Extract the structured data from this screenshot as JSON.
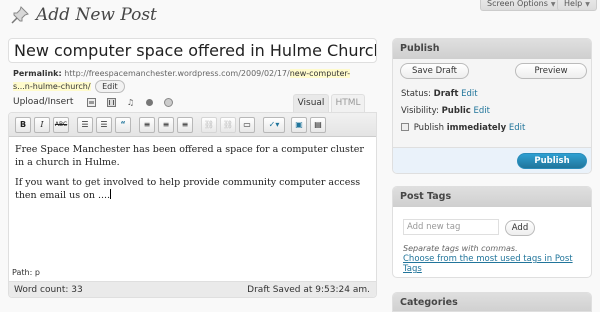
{
  "screen_meta": {
    "screen_options": "Screen Options",
    "help": "Help"
  },
  "page": {
    "heading": "Add New Post"
  },
  "post": {
    "title": "New computer space offered in Hulme Church",
    "permalink_label": "Permalink:",
    "permalink_base": "http://freespacemanchester.wordpress.com/2009/02/17/",
    "permalink_slug": "new-computer-s...n-hulme-church/",
    "permalink_edit": "Edit"
  },
  "media": {
    "upload_insert_label": "Upload/Insert",
    "icons": [
      "image-icon",
      "video-icon",
      "music-icon",
      "media-icon"
    ]
  },
  "editor": {
    "tabs": [
      "Visual",
      "HTML"
    ],
    "active_tab": "Visual",
    "toolbar": [
      "bold-icon",
      "italic-icon",
      "strikethrough-icon",
      "bullet-list-icon",
      "numbered-list-icon",
      "blockquote-icon",
      "align-left-icon",
      "align-center-icon",
      "align-right-icon",
      "insert-link-icon",
      "unlink-icon",
      "insert-more-icon",
      "spellcheck-icon",
      "fullscreen-icon",
      "kitchen-sink-icon"
    ],
    "paragraphs": [
      "Free Space Manchester has been offered a space for a computer cluster in a church in Hulme.",
      "If you want to get involved to help provide community computer access then email us on ...."
    ],
    "path": "Path: p",
    "word_count": "Word count: 33",
    "draft_saved": "Draft Saved at 9:53:24 am."
  },
  "publish_box": {
    "title": "Publish",
    "save_draft": "Save Draft",
    "preview": "Preview",
    "status_label": "Status:",
    "status_value": "Draft",
    "visibility_label": "Visibility:",
    "visibility_value": "Public",
    "publish_label": "Publish",
    "publish_value": "immediately",
    "edit": "Edit",
    "publish_button": "Publish"
  },
  "tags_box": {
    "title": "Post Tags",
    "placeholder": "Add new tag",
    "add_button": "Add",
    "hint": "Separate tags with commas.",
    "most_used_link": "Choose from the most used tags in Post Tags"
  },
  "categories_box": {
    "title": "Categories"
  }
}
